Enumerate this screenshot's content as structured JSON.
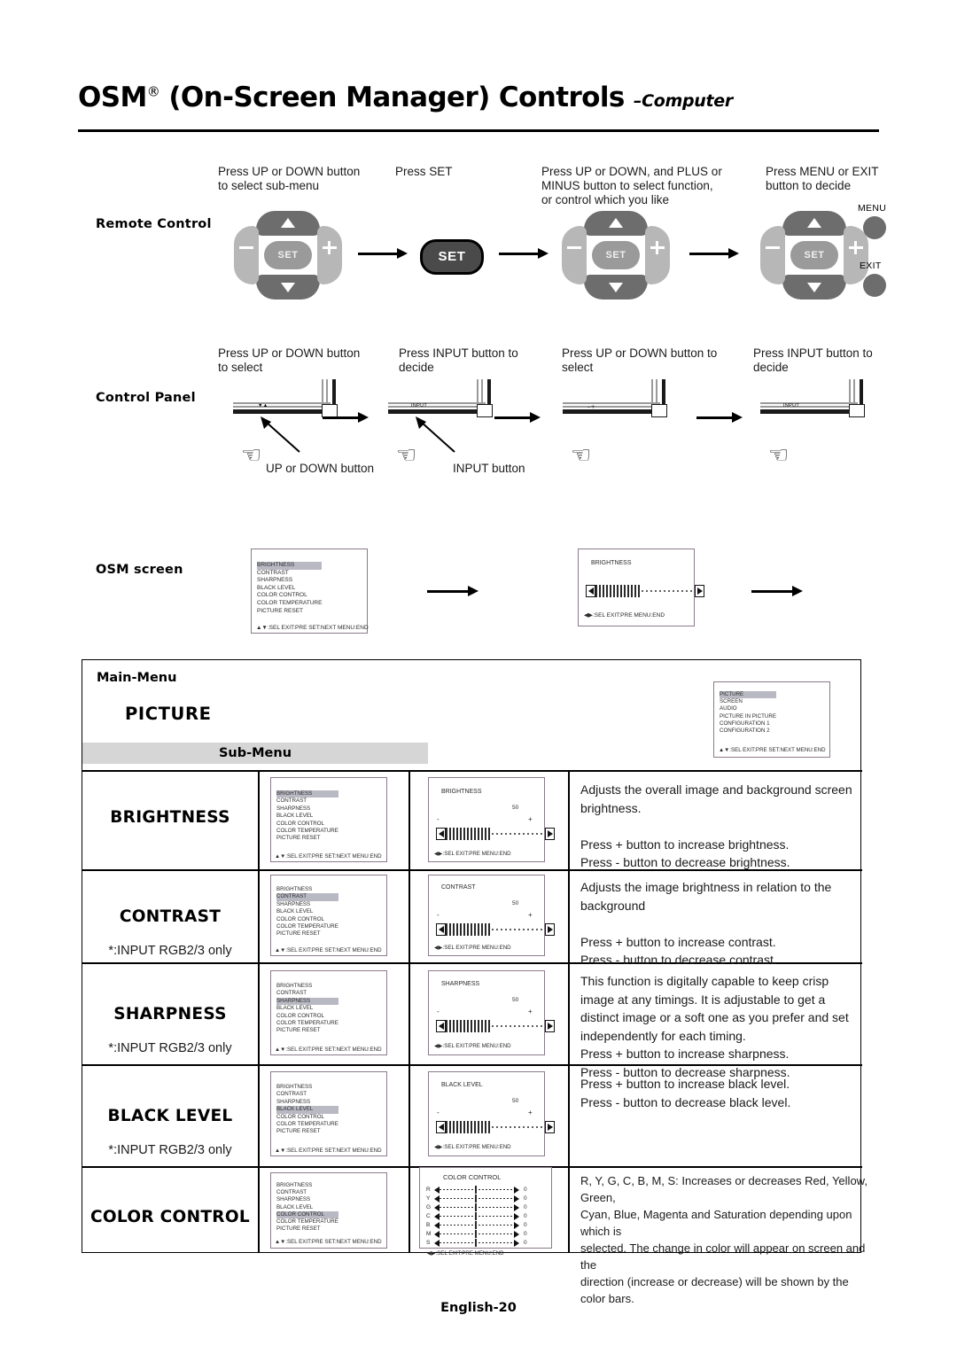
{
  "page": {
    "title_main": "OSM",
    "title_sup": "®",
    "title_rest": " (On-Screen Manager) Controls ",
    "title_sub": "–Computer",
    "footer": "English-20"
  },
  "remote_row": {
    "label": "Remote Control",
    "steps": [
      "Press UP or DOWN button\nto select sub-menu",
      "Press SET",
      "Press UP or DOWN, and PLUS or\nMINUS button to select  function,\nor control which you like",
      "Press MENU or EXIT\nbutton to decide"
    ],
    "set_label": "SET",
    "pad_center": "SET",
    "menu_label": "MENU",
    "exit_label": "EXIT"
  },
  "control_panel_row": {
    "label": "Control Panel",
    "steps": [
      "Press UP or DOWN button\nto select",
      "Press INPUT button to\ndecide",
      "Press UP or DOWN button to\nselect",
      "Press INPUT button to\ndecide"
    ],
    "callouts": [
      "UP or DOWN button",
      "INPUT button"
    ],
    "panel_glyphs": [
      "▼▲",
      "INPUT",
      "–＋",
      "INPUT"
    ]
  },
  "osm_screen_row": {
    "label": "OSM screen",
    "menu_items": [
      "BRIGHTNESS",
      "CONTRAST",
      "SHARPNESS",
      "BLACK LEVEL",
      "COLOR CONTROL",
      "COLOR TEMPERATURE",
      "PICTURE RESET"
    ],
    "selected": "BRIGHTNESS",
    "footer_list": "▲▼:SEL EXIT:PRE SET:NEXT MENU:END",
    "adjust_title": "BRIGHTNESS",
    "footer_adjust": "◀▶:SEL    EXIT:PRE    MENU:END"
  },
  "table": {
    "main_menu_label": "Main-Menu",
    "picture_label": "PICTURE",
    "sub_menu_label": "Sub-Menu",
    "main_menu_box": {
      "items": [
        "PICTURE",
        "SCREEN",
        "AUDIO",
        "PICTURE IN PICTURE",
        "CONFIGURATION 1",
        "CONFIGURATION 2"
      ],
      "selected": "PICTURE",
      "footer": "▲▼:SEL EXIT:PRE SET:NEXT MENU:END"
    },
    "sub_menu_items": [
      "BRIGHTNESS",
      "CONTRAST",
      "SHARPNESS",
      "BLACK LEVEL",
      "COLOR CONTROL",
      "COLOR TEMPERATURE",
      "PICTURE RESET"
    ],
    "list_footer": "▲▼:SEL EXIT:PRE SET:NEXT MENU:END",
    "adjust_footer": "◀▶:SEL    EXIT:PRE    MENU:END",
    "input_note": "*:INPUT RGB2/3 only",
    "rows": [
      {
        "name": "BRIGHTNESS",
        "note": "",
        "selected": "BRIGHTNESS",
        "adjust_title": "BRIGHTNESS",
        "value": "50",
        "minus": "-",
        "plus": "+",
        "desc": "Adjusts the overall image and background screen\nbrightness.\n\nPress + button to increase brightness.\nPress - button to decrease brightness."
      },
      {
        "name": "CONTRAST",
        "note": "*:INPUT RGB2/3 only",
        "selected": "CONTRAST",
        "adjust_title": "CONTRAST",
        "value": "50",
        "minus": "-",
        "plus": "+",
        "desc": "Adjusts the image brightness in relation to the\nbackground\n\nPress + button to increase contrast.\nPress - button to decrease contrast."
      },
      {
        "name": "SHARPNESS",
        "note": "*:INPUT RGB2/3 only",
        "selected": "SHARPNESS",
        "adjust_title": "SHARPNESS",
        "value": "50",
        "minus": "-",
        "plus": "+",
        "desc": "This function is digitally capable to keep crisp\nimage at any timings.  It is adjustable to get a\ndistinct image or a soft one as you prefer and set\nindependently for each timing.\nPress + button to increase sharpness.\nPress - button to decrease sharpness."
      },
      {
        "name": "BLACK LEVEL",
        "note": "*:INPUT RGB2/3 only",
        "selected": "BLACK LEVEL",
        "adjust_title": "BLACK LEVEL",
        "value": "50",
        "minus": "-",
        "plus": "+",
        "desc": "Press + button to increase black level.\nPress - button to decrease black level."
      },
      {
        "name": "COLOR CONTROL",
        "note": "",
        "selected": "COLOR CONTROL",
        "adjust_title": "COLOR CONTROL",
        "value": "0",
        "minus": "-",
        "plus": "+",
        "desc": "R, Y, G, C, B, M, S:  Increases or decreases Red, Yellow, Green,\nCyan, Blue, Magenta and Saturation depending upon which is\nselected.  The change in color will appear on screen and the\ndirection (increase or decrease) will be shown by the color bars."
      }
    ],
    "color_control_rows": [
      {
        "label": "R",
        "value": "0"
      },
      {
        "label": "Y",
        "value": "0"
      },
      {
        "label": "G",
        "value": "0"
      },
      {
        "label": "C",
        "value": "0"
      },
      {
        "label": "B",
        "value": "0"
      },
      {
        "label": "M",
        "value": "0"
      },
      {
        "label": "S",
        "value": "0"
      }
    ]
  },
  "colors": {
    "osm_border": "#8b7a8b",
    "highlight": "#b9b9c4",
    "subhdr_bg": "#d6d6d6",
    "pad_dark": "#6d6d6d",
    "pad_light": "#b7b7b7"
  }
}
